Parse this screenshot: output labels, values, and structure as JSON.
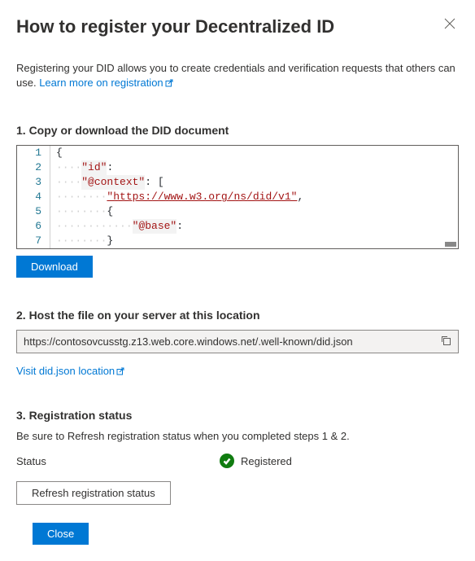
{
  "title": "How to register your Decentralized ID",
  "intro_text": "Registering your DID allows you to create credentials and verification requests that others can use. ",
  "intro_link": "Learn more on registration",
  "step1": {
    "heading": "1. Copy or download the DID document",
    "download_label": "Download",
    "code": {
      "line1_punc": "{",
      "line2_prop": "\"id\"",
      "line2_punc": ":",
      "line3_prop": "\"@context\"",
      "line3_punc": ": [",
      "line4_str": "\"https://www.w3.org/ns/did/v1\"",
      "line4_punc": ",",
      "line5_punc": "{",
      "line6_prop": "\"@base\"",
      "line6_punc": ":",
      "line7_punc": "}"
    }
  },
  "step2": {
    "heading": "2. Host the file on your server at this location",
    "url": "https://contosovcusstg.z13.web.core.windows.net/.well-known/did.json",
    "visit_link": "Visit did.json location"
  },
  "step3": {
    "heading": "3. Registration status",
    "description": "Be sure to Refresh registration status when you completed steps 1 & 2.",
    "status_label": "Status",
    "status_value": "Registered",
    "refresh_label": "Refresh registration status"
  },
  "close_label": "Close"
}
